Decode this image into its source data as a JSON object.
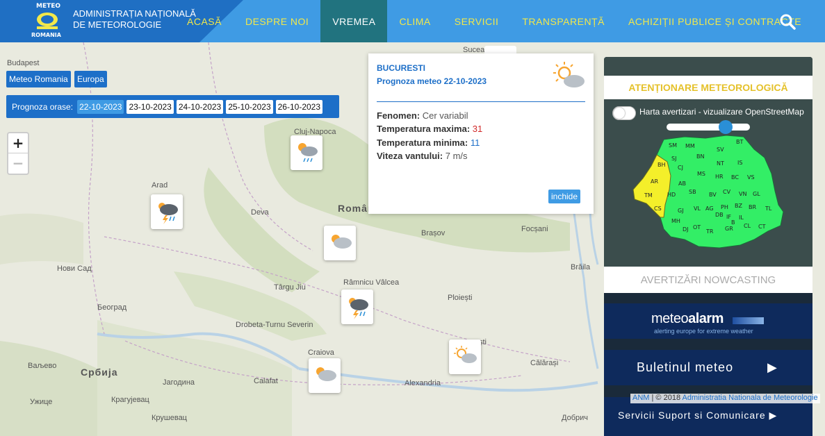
{
  "header": {
    "logo_top": "METEO",
    "logo_bottom": "ROMANIA",
    "agency_line1": "ADMINISTRAȚIA NAȚIONALĂ",
    "agency_line2": "DE METEOROLOGIE",
    "nav": [
      "ACASĂ",
      "DESPRE NOI",
      "VREMEA",
      "CLIMA",
      "SERVICII",
      "TRANSPARENȚĂ",
      "ACHIZIȚII PUBLICE ȘI CONTRACTE"
    ],
    "active_nav": "VREMEA",
    "search_icon": "search-icon"
  },
  "map_controls": {
    "meteo_romania": "Meteo Romania",
    "europa": "Europa",
    "prognoza_label": "Prognoza orase:",
    "dates": [
      "22-10-2023",
      "23-10-2023",
      "24-10-2023",
      "25-10-2023",
      "26-10-2023"
    ],
    "selected_date": "22-10-2023",
    "zoom_in": "+",
    "zoom_out": "−"
  },
  "places": {
    "budapest": "Budapest",
    "suceava": "Suceava",
    "cluj": "Cluj-Napoca",
    "arad": "Arad",
    "deva": "Deva",
    "romania": "Românie",
    "brasov": "Brașov",
    "focsani": "Focșani",
    "novi_sad": "Нови Сад",
    "braila": "Brăila",
    "targu_jiu": "Târgu Jiu",
    "ramnicu": "Râmnicu Vâlcea",
    "beograd": "Београд",
    "ploiesti": "Ploiești",
    "drobeta": "Drobeta-Turnu Severin",
    "bucuresti": "ști",
    "craiova": "Craiova",
    "valjevo": "Ваљево",
    "srbija": "Србија",
    "calarasi": "Călărași",
    "calafat": "Calafat",
    "alexandria": "Alexandria",
    "jagodina": "Јагодина",
    "uzice": "Ужице",
    "kragujevac": "Крагујевац",
    "krusevac": "Крушевац",
    "dobrich": "Добрич"
  },
  "popup": {
    "city": "BUCURESTI",
    "forecast": "Prognoza meteo 22-10-2023",
    "fenomen_label": "Fenomen:",
    "fenomen_value": "Cer variabil",
    "tmax_label": "Temperatura maxima:",
    "tmax_value": "31",
    "tmin_label": "Temperatura minima:",
    "tmin_value": "11",
    "vant_label": "Viteza vantului:",
    "vant_value": "7 m/s",
    "close_label": "inchide"
  },
  "panel": {
    "warning_title": "ATENȚIONARE METEOROLOGICĂ",
    "toggle_label": "Harta avertizari - vizualizare OpenStreetMap",
    "counties": [
      "SM",
      "MM",
      "SV",
      "BT",
      "BH",
      "SJ",
      "CJ",
      "BN",
      "NT",
      "IS",
      "AR",
      "MS",
      "HR",
      "BC",
      "VS",
      "TM",
      "HD",
      "AB",
      "CV",
      "VN",
      "GL",
      "CS",
      "SB",
      "BV",
      "BZ",
      "BR",
      "TL",
      "GJ",
      "VL",
      "AG",
      "PH",
      "IL",
      "MH",
      "OT",
      "DB",
      "IF",
      "CL",
      "CT",
      "DJ",
      "TR",
      "GR",
      "B"
    ],
    "nowcasting": "AVERTIZĂRI NOWCASTING",
    "meteoalarm_1": "meteo",
    "meteoalarm_2": "alarm",
    "meteoalarm_sub": "alerting europe for extreme weather",
    "buletin": "Buletinul meteo",
    "servicii": "Servicii Suport si Comunicare"
  },
  "attribution": {
    "anm": "ANM",
    "year": "| © 2018",
    "link": "Administratia Nationala de Meteorologie"
  },
  "colors": {
    "nav_bg": "#3f9be4",
    "brand_bg": "#1f6fc3",
    "nav_text": "#f2e84a",
    "active_bg": "#21737f",
    "warning_yellow": "#f4ef2a",
    "warning_green": "#33ee66"
  }
}
